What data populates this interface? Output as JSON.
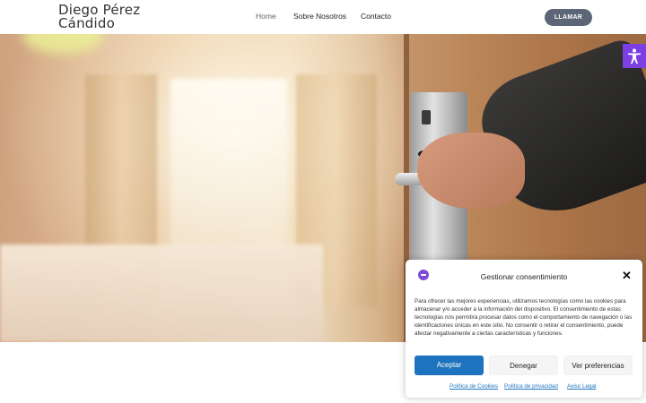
{
  "header": {
    "brand": "Diego Pérez Cándido",
    "nav": [
      "Home",
      "Sobre Nosotros",
      "Contacto"
    ],
    "call_button": "LLAMAR"
  },
  "colors": {
    "accent_purple": "#7b3fe4",
    "call_button_bg": "#5c6676",
    "accept_button_bg": "#1e73be",
    "link": "#1e73be"
  },
  "accessibility_button": {
    "icon": "accessibility-icon"
  },
  "consent": {
    "title": "Gestionar consentimiento",
    "body": "Para ofrecer las mejores experiencias, utilizamos tecnologías como las cookies para almacenar y/o acceder a la información del dispositivo. El consentimiento de estas tecnologías nos permitirá procesar datos como el comportamiento de navegación o las identificaciones únicas en este sitio. No consentir o retirar el consentimiento, puede afectar negativamente a ciertas características y funciones.",
    "buttons": {
      "accept": "Aceptar",
      "deny": "Denegar",
      "prefs": "Ver preferencias"
    },
    "links": [
      "Política de Cookies",
      "Política de privacidad",
      "Aviso Legal"
    ]
  }
}
